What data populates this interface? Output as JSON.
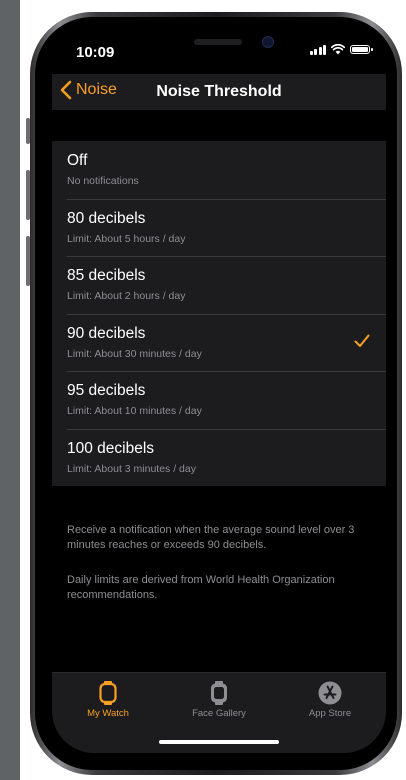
{
  "colors": {
    "accent": "#f79f24",
    "background": "#000000",
    "cell": "#1c1c1e",
    "secondary_text": "#8e8e93",
    "separator": "#3a3a3c"
  },
  "status_bar": {
    "time": "10:09",
    "icons": [
      "cellular-signal-icon",
      "wifi-icon",
      "battery-icon"
    ]
  },
  "nav": {
    "back_label": "Noise",
    "title": "Noise Threshold"
  },
  "options": [
    {
      "title": "Off",
      "subtitle": "No notifications",
      "selected": false
    },
    {
      "title": "80 decibels",
      "subtitle": "Limit: About 5 hours / day",
      "selected": false
    },
    {
      "title": "85 decibels",
      "subtitle": "Limit: About 2 hours / day",
      "selected": false
    },
    {
      "title": "90 decibels",
      "subtitle": "Limit: About 30 minutes / day",
      "selected": true
    },
    {
      "title": "95 decibels",
      "subtitle": "Limit: About 10 minutes / day",
      "selected": false
    },
    {
      "title": "100 decibels",
      "subtitle": "Limit: About 3 minutes / day",
      "selected": false
    }
  ],
  "footer": {
    "note_1": "Receive a notification when the average sound level over 3 minutes reaches or exceeds 90 decibels.",
    "note_2": "Daily limits are derived from World Health Organization recommendations."
  },
  "tabbar": {
    "tabs": [
      {
        "label": "My Watch",
        "icon": "watch-icon",
        "active": true
      },
      {
        "label": "Face Gallery",
        "icon": "face-gallery-icon",
        "active": false
      },
      {
        "label": "App Store",
        "icon": "app-store-icon",
        "active": false
      }
    ]
  }
}
